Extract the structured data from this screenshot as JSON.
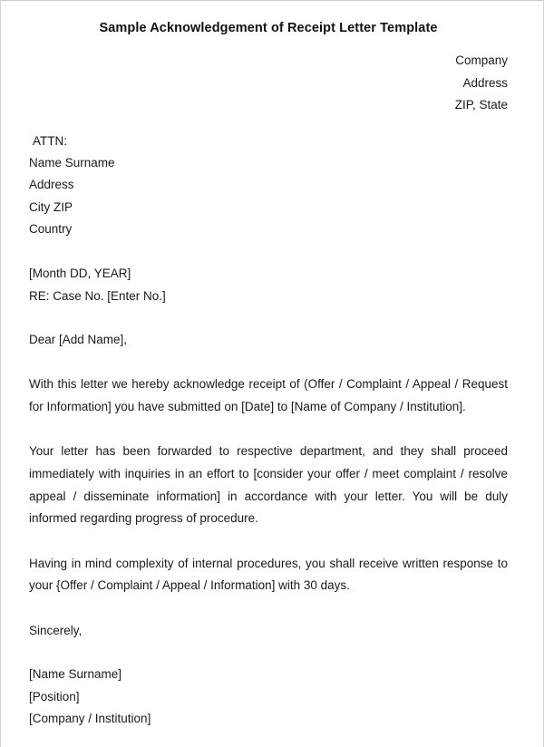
{
  "document": {
    "title": "Sample Acknowledgement of Receipt Letter Template",
    "sender": {
      "line1": "Company",
      "line2": "Address",
      "line3": "ZIP, State"
    },
    "recipient": {
      "attn_label": "ATTN:",
      "name": "Name Surname",
      "address": "Address",
      "city_zip": "City ZIP",
      "country": "Country"
    },
    "meta": {
      "date": "[Month DD, YEAR]",
      "subject": "RE: Case No. [Enter No.]"
    },
    "salutation": "Dear [Add Name],",
    "paragraphs": {
      "p1": "With this letter we hereby acknowledge receipt of (Offer / Complaint / Appeal / Request for Information] you have submitted on [Date] to [Name of Company / Institution].",
      "p2": "Your letter has been forwarded to respective department, and they shall proceed immediately with inquiries in an effort to [consider your offer / meet complaint / resolve appeal / disseminate information] in accordance with your letter. You will be duly informed regarding progress of procedure.",
      "p3": "Having in mind complexity of internal procedures, you shall receive written response to your {Offer / Complaint / Appeal / Information] with 30 days."
    },
    "closing": "Sincerely,",
    "signature": {
      "name": "[Name Surname]",
      "position": "[Position]",
      "organization": "[Company / Institution]"
    }
  }
}
